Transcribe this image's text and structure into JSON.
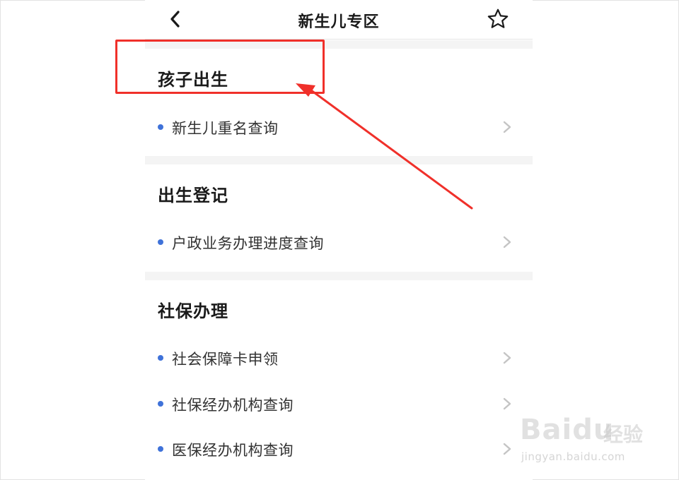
{
  "header": {
    "title": "新生儿专区",
    "back_icon": "chevron-left-icon",
    "favorite_icon": "star-outline-icon"
  },
  "sections": [
    {
      "title": "孩子出生",
      "items": [
        {
          "label": "新生儿重名查询"
        }
      ]
    },
    {
      "title": "出生登记",
      "items": [
        {
          "label": "户政业务办理进度查询"
        }
      ]
    },
    {
      "title": "社保办理",
      "items": [
        {
          "label": "社会保障卡申领"
        },
        {
          "label": "社保经办机构查询"
        },
        {
          "label": "医保经办机构查询"
        }
      ]
    }
  ],
  "annotation": {
    "color": "#f0302a"
  },
  "watermark": {
    "logo_text": "Baidu",
    "cn_text": "经验",
    "url_text": "jingyan.baidu.com"
  },
  "colors": {
    "bullet": "#3f72d9",
    "band": "#f4f4f4",
    "chevron": "#c4c4c4"
  }
}
